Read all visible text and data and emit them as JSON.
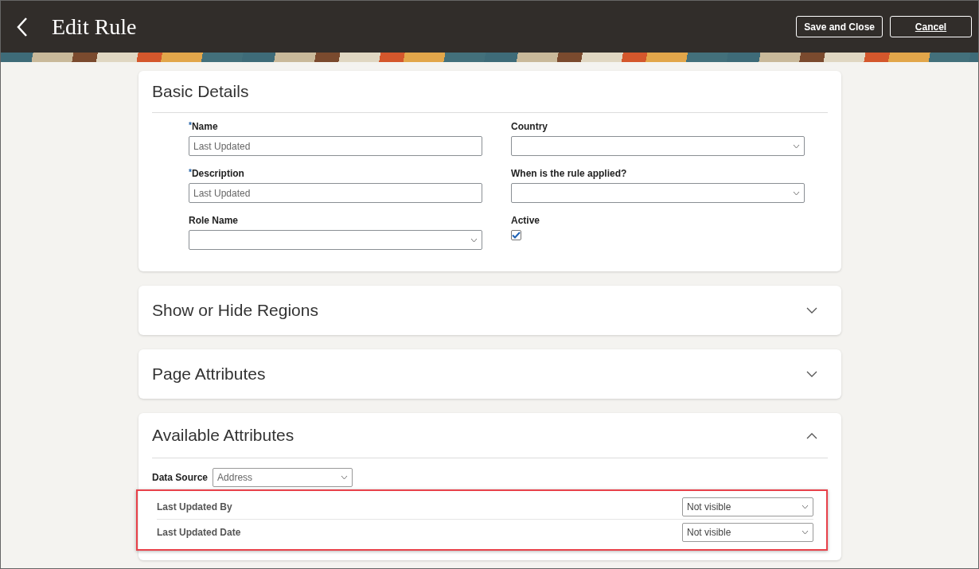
{
  "header": {
    "title": "Edit Rule",
    "buttons": [
      {
        "label": "Save and Close",
        "kind": "primary"
      },
      {
        "label": "Cancel",
        "kind": "secondary"
      }
    ]
  },
  "basic_details": {
    "title": "Basic Details",
    "left_fields": [
      {
        "required_mark": "*",
        "label": "Name",
        "kind": "text",
        "value": "Last Updated"
      },
      {
        "required_mark": "*",
        "label": "Description",
        "kind": "text",
        "value": "Last Updated"
      },
      {
        "label": "Role Name",
        "kind": "select"
      }
    ],
    "right_fields": [
      {
        "label": "Country",
        "kind": "select"
      },
      {
        "label": "When is the rule applied?",
        "kind": "select"
      },
      {
        "label": "Active",
        "kind": "checkbox",
        "checked": true
      }
    ]
  },
  "sections": [
    {
      "title": "Show or Hide Regions",
      "expanded": false
    },
    {
      "title": "Page Attributes",
      "expanded": false
    },
    {
      "title": "Available Attributes",
      "expanded": true
    }
  ],
  "available_attributes": {
    "data_source": {
      "label": "Data Source",
      "value": "Address"
    },
    "rows": [
      {
        "name": "Last Updated By",
        "visibility": "Not visible"
      },
      {
        "name": "Last Updated Date",
        "visibility": "Not visible"
      }
    ]
  }
}
